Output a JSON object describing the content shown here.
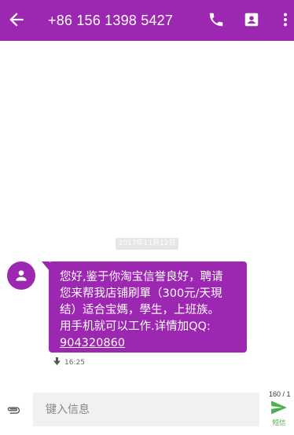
{
  "app_bar": {
    "title": "+86 156 1398 5427",
    "back_icon": "arrow-left-icon",
    "call_icon": "phone-icon",
    "contact_icon": "contact-card-icon",
    "more_icon": "more-vertical-icon",
    "color": "#9c27b0"
  },
  "conversation": {
    "date": "2017年11月12日",
    "message": {
      "lines": [
        "您好,鉴于你淘宝信誉良好，聘请",
        "您来帮我店铺刷單（300元/天現",
        "结）适合宝媽，學生，上班族。",
        "用手机就可以工作.详情加QQ:"
      ],
      "link": "904320860",
      "time": "16:25",
      "status_icon": "download-arrow-icon"
    }
  },
  "composer": {
    "placeholder": "键入信息",
    "counter": "160 / 1",
    "send_label": "短信",
    "attach_icon": "paperclip-icon",
    "send_icon": "send-icon",
    "send_color": "#4caf50"
  }
}
